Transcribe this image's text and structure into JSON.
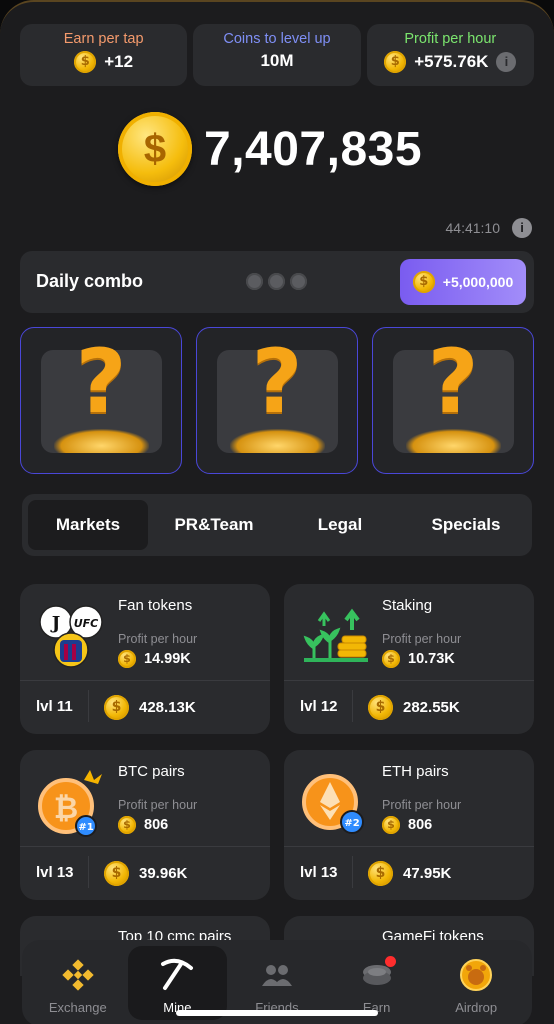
{
  "stats": [
    {
      "label": "Earn per tap",
      "value": "+12",
      "label_color": "#f49a6c"
    },
    {
      "label": "Coins to level up",
      "value": "10M",
      "label_color": "#7f8ff5"
    },
    {
      "label": "Profit per hour",
      "value": "+575.76K",
      "label_color": "#7be56e"
    }
  ],
  "balance": "7,407,835",
  "timer": "44:41:10",
  "daily_combo": {
    "title": "Daily combo",
    "reward": "+5,000,000",
    "found": 0,
    "total": 3
  },
  "tabs": [
    "Markets",
    "PR&Team",
    "Legal",
    "Specials"
  ],
  "active_tab": "Markets",
  "cards": [
    {
      "name": "Fan tokens",
      "profit_label": "Profit per hour",
      "profit": "14.99K",
      "level": "lvl 11",
      "cost": "428.13K",
      "icon": "fan-tokens-logos"
    },
    {
      "name": "Staking",
      "profit_label": "Profit per hour",
      "profit": "10.73K",
      "level": "lvl 12",
      "cost": "282.55K",
      "icon": "staking-plants-coins"
    },
    {
      "name": "BTC pairs",
      "profit_label": "Profit per hour",
      "profit": "806",
      "level": "lvl 13",
      "cost": "39.96K",
      "icon": "bitcoin-badge-1"
    },
    {
      "name": "ETH pairs",
      "profit_label": "Profit per hour",
      "profit": "806",
      "level": "lvl 13",
      "cost": "47.95K",
      "icon": "ethereum-badge-2"
    },
    {
      "name": "Top 10 cmc pairs"
    },
    {
      "name": "GameFi tokens"
    }
  ],
  "nav": [
    {
      "label": "Exchange",
      "icon": "binance-icon"
    },
    {
      "label": "Mine",
      "icon": "pickaxe-icon",
      "active": true
    },
    {
      "label": "Friends",
      "icon": "friends-icon"
    },
    {
      "label": "Earn",
      "icon": "coins-stack-icon",
      "badge": true
    },
    {
      "label": "Airdrop",
      "icon": "hamster-coin-icon"
    }
  ]
}
